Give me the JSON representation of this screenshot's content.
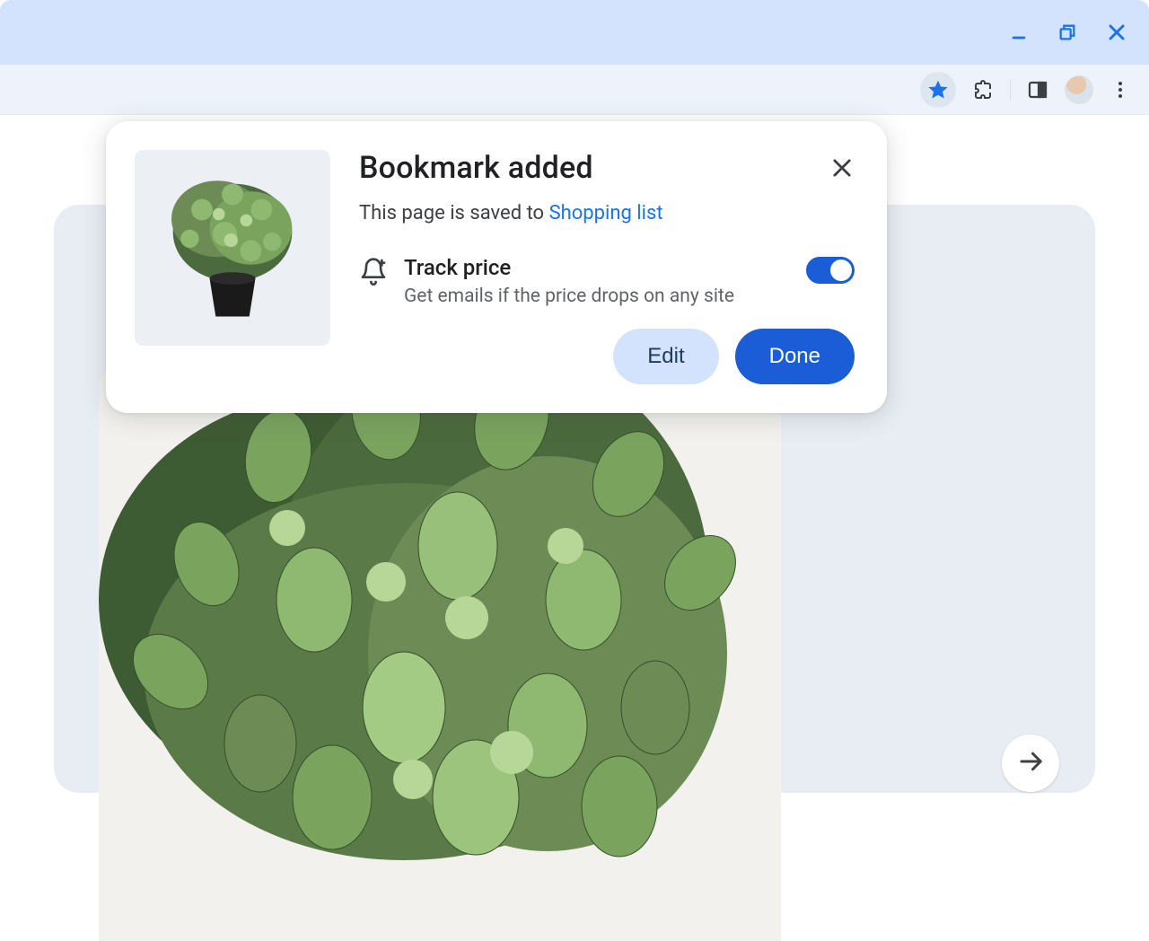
{
  "window": {
    "minimize_icon": "minimize",
    "maximize_icon": "restore",
    "close_icon": "close"
  },
  "toolbar": {
    "star_icon": "bookmark-star",
    "extensions_icon": "puzzle",
    "sidepanel_icon": "side-panel",
    "avatar_icon": "profile-avatar",
    "menu_icon": "more-vert"
  },
  "bookmark_popup": {
    "title": "Bookmark added",
    "subtitle_prefix": "This page is saved to ",
    "folder_link": "Shopping list",
    "track": {
      "title": "Track price",
      "description": "Get emails if the price drops on any site",
      "enabled": true
    },
    "buttons": {
      "edit": "Edit",
      "done": "Done"
    },
    "close_icon": "close",
    "bell_icon": "bell-plus",
    "thumbnail": "potted-plant-thumbnail"
  },
  "page": {
    "product_image": "potted-plant-large",
    "next_icon": "arrow-right"
  },
  "colors": {
    "accent": "#1a73e8",
    "primary_btn": "#1a5dd6",
    "secondary_btn_bg": "#d3e3fd",
    "titlebar_bg": "#d3e3fd",
    "toolbar_bg": "#eef3fb"
  }
}
